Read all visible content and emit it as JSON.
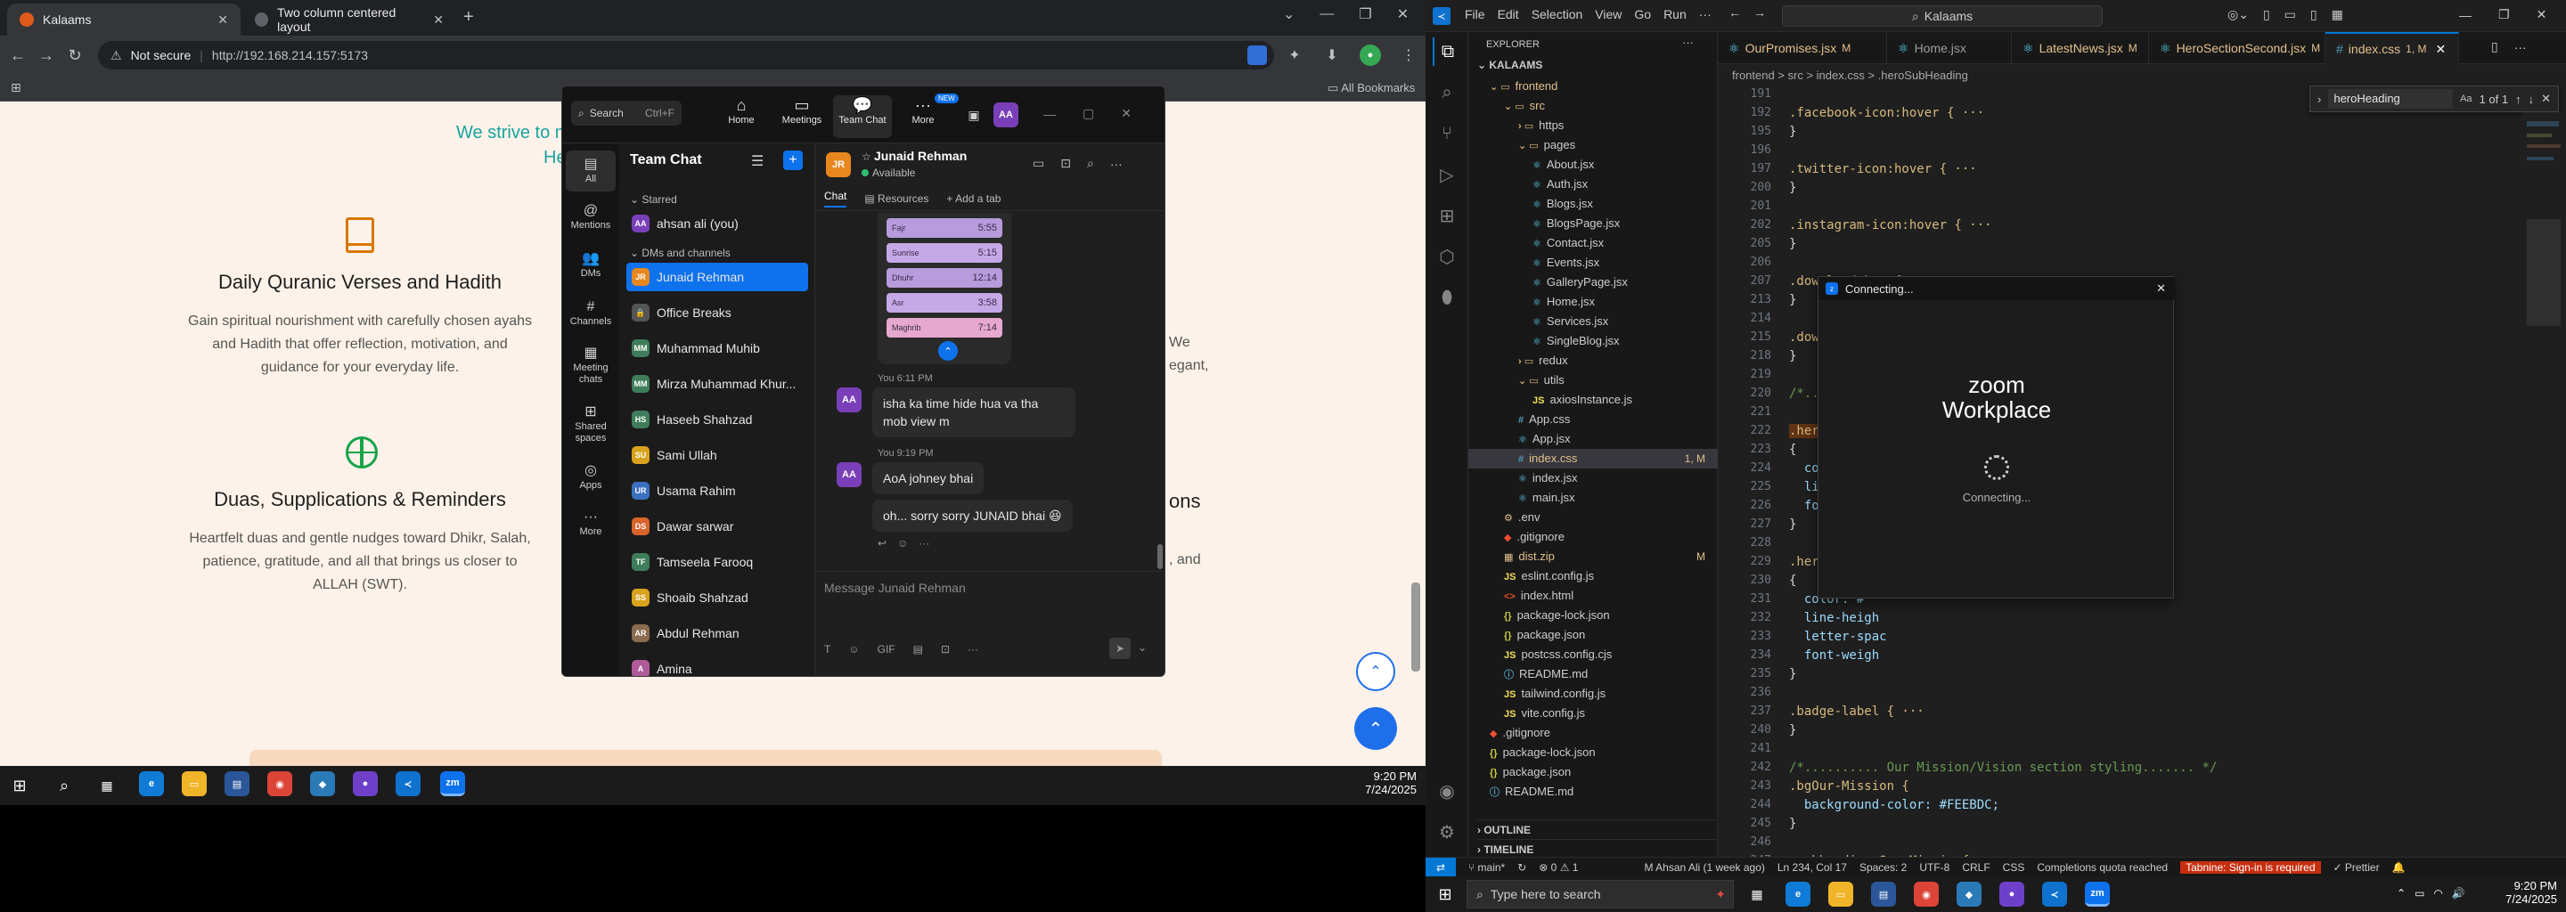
{
  "left": {
    "chrome": {
      "tabs": [
        {
          "title": "Kalaams",
          "active": true
        },
        {
          "title": "Two column centered layout",
          "active": false
        }
      ],
      "new_tab": "+",
      "not_secure": "Not secure",
      "url": "http://192.168.214.157:5173",
      "all_bookmarks": "All Bookmarks"
    },
    "page": {
      "tagline": "We strive to m",
      "tagline2": "He",
      "features": [
        {
          "title": "Daily Quranic Verses and Hadith",
          "desc": "Gain spiritual nourishment with carefully chosen ayahs and Hadith that offer reflection, motivation, and guidance for your everyday life."
        },
        {
          "title": "Duas, Supplications & Reminders",
          "desc": "Heartfelt duas and gentle nudges toward Dhikr, Salah, patience, gratitude, and all that brings us closer to ALLAH (SWT)."
        }
      ],
      "partial_right": [
        "We",
        "egant,",
        "ons",
        ", and"
      ]
    },
    "zoom": {
      "search_label": "Search",
      "search_shortcut": "Ctrl+F",
      "nav": [
        {
          "label": "Home",
          "icon": "home-icon"
        },
        {
          "label": "Meetings",
          "icon": "video-icon"
        },
        {
          "label": "Team Chat",
          "icon": "chat-icon"
        },
        {
          "label": "More",
          "icon": "more-icon"
        }
      ],
      "new_badge": "NEW",
      "user_initials": "AA",
      "rail": [
        {
          "label": "All"
        },
        {
          "label": "Mentions"
        },
        {
          "label": "DMs"
        },
        {
          "label": "Channels"
        },
        {
          "label": "Meeting chats"
        },
        {
          "label": "Shared spaces"
        },
        {
          "label": "Apps"
        },
        {
          "label": "More"
        }
      ],
      "team_chat_title": "Team Chat",
      "starred_label": "Starred",
      "starred_item": "ahsan ali (you)",
      "dms_label": "DMs and channels",
      "contacts": [
        {
          "name": "Junaid Rehman",
          "initials": "JR",
          "color": "#e8871e",
          "selected": true
        },
        {
          "name": "Office Breaks",
          "initials": "🔒",
          "color": "#555555",
          "selected": false
        },
        {
          "name": "Muhammad Muhib",
          "initials": "MM",
          "color": "#3f7d5a",
          "selected": false
        },
        {
          "name": "Mirza Muhammad Khur...",
          "initials": "MM",
          "color": "#3f7d5a",
          "selected": false
        },
        {
          "name": "Haseeb Shahzad",
          "initials": "HS",
          "color": "#3f7d5a",
          "selected": false
        },
        {
          "name": "Sami Ullah",
          "initials": "SU",
          "color": "#d9a21c",
          "selected": false
        },
        {
          "name": "Usama Rahim",
          "initials": "UR",
          "color": "#3b6fbf",
          "selected": false
        },
        {
          "name": "Dawar sarwar",
          "initials": "DS",
          "color": "#d8642c",
          "selected": false
        },
        {
          "name": "Tamseela Farooq",
          "initials": "TF",
          "color": "#3f7d5a",
          "selected": false
        },
        {
          "name": "Shoaib Shahzad",
          "initials": "SS",
          "color": "#d9a21c",
          "selected": false
        },
        {
          "name": "Abdul Rehman",
          "initials": "AR",
          "color": "#8a6b4f",
          "selected": false
        },
        {
          "name": "Amina",
          "initials": "A",
          "color": "#b05a9a",
          "selected": false
        }
      ],
      "conv_name": "Junaid Rehman",
      "conv_status": "Available",
      "conv_initials": "JR",
      "conv_tabs": [
        "Chat",
        "Resources",
        "Add a tab"
      ],
      "prayer_rows": [
        {
          "name": "Fajr",
          "time": "5:55"
        },
        {
          "name": "Sunrise",
          "time": "5:15"
        },
        {
          "name": "Dhuhr",
          "time": "12:14"
        },
        {
          "name": "Asr",
          "time": "3:58"
        },
        {
          "name": "Maghrib",
          "time": "7:14"
        }
      ],
      "messages": [
        {
          "meta": "You 6:11 PM",
          "text": "isha ka time hide hua va tha mob view m"
        },
        {
          "meta": "You 9:19 PM",
          "text": "AoA johney bhai"
        },
        {
          "meta": "",
          "text": "oh... sorry sorry JUNAID bhai 😆"
        }
      ],
      "sender_initials": "AA",
      "composer_placeholder": "Message Junaid Rehman"
    },
    "taskbar": {
      "time": "9:20 PM",
      "date": "7/24/2025"
    }
  },
  "right": {
    "vscode": {
      "menu": [
        "File",
        "Edit",
        "Selection",
        "View",
        "Go",
        "Run"
      ],
      "search_box": "Kalaams",
      "explorer_title": "EXPLORER",
      "root": "KALAAMS",
      "tree": [
        {
          "name": "frontend",
          "depth": 1,
          "type": "folder",
          "open": true,
          "color": "#e2c08d"
        },
        {
          "name": "src",
          "depth": 2,
          "type": "folder",
          "open": true,
          "color": "#e2c08d"
        },
        {
          "name": "https",
          "depth": 3,
          "type": "folder",
          "open": false,
          "color": "#cccccc"
        },
        {
          "name": "pages",
          "depth": 3,
          "type": "folder",
          "open": true,
          "color": "#cccccc"
        },
        {
          "name": "About.jsx",
          "depth": 4,
          "type": "jsx",
          "color": "#cccccc"
        },
        {
          "name": "Auth.jsx",
          "depth": 4,
          "type": "jsx",
          "color": "#cccccc"
        },
        {
          "name": "Blogs.jsx",
          "depth": 4,
          "type": "jsx",
          "color": "#cccccc"
        },
        {
          "name": "BlogsPage.jsx",
          "depth": 4,
          "type": "jsx",
          "color": "#cccccc"
        },
        {
          "name": "Contact.jsx",
          "depth": 4,
          "type": "jsx",
          "color": "#cccccc"
        },
        {
          "name": "Events.jsx",
          "depth": 4,
          "type": "jsx",
          "color": "#cccccc"
        },
        {
          "name": "GalleryPage.jsx",
          "depth": 4,
          "type": "jsx",
          "color": "#cccccc"
        },
        {
          "name": "Home.jsx",
          "depth": 4,
          "type": "jsx",
          "color": "#cccccc"
        },
        {
          "name": "Services.jsx",
          "depth": 4,
          "type": "jsx",
          "color": "#cccccc"
        },
        {
          "name": "SingleBlog.jsx",
          "depth": 4,
          "type": "jsx",
          "color": "#cccccc"
        },
        {
          "name": "redux",
          "depth": 3,
          "type": "folder",
          "open": false,
          "color": "#cccccc"
        },
        {
          "name": "utils",
          "depth": 3,
          "type": "folder",
          "open": true,
          "color": "#cccccc"
        },
        {
          "name": "axiosInstance.js",
          "depth": 4,
          "type": "js",
          "color": "#cccccc"
        },
        {
          "name": "App.css",
          "depth": 3,
          "type": "css",
          "color": "#cccccc"
        },
        {
          "name": "App.jsx",
          "depth": 3,
          "type": "jsx",
          "color": "#cccccc"
        },
        {
          "name": "index.css",
          "depth": 3,
          "type": "css",
          "color": "#e2c08d",
          "badge": "1, M",
          "selected": true
        },
        {
          "name": "index.jsx",
          "depth": 3,
          "type": "jsx",
          "color": "#cccccc"
        },
        {
          "name": "main.jsx",
          "depth": 3,
          "type": "jsx",
          "color": "#cccccc"
        },
        {
          "name": ".env",
          "depth": 2,
          "type": "env",
          "color": "#cccccc"
        },
        {
          "name": ".gitignore",
          "depth": 2,
          "type": "git",
          "color": "#cccccc"
        },
        {
          "name": "dist.zip",
          "depth": 2,
          "type": "zip",
          "color": "#e2c08d",
          "badge": "M"
        },
        {
          "name": "eslint.config.js",
          "depth": 2,
          "type": "js",
          "color": "#cccccc"
        },
        {
          "name": "index.html",
          "depth": 2,
          "type": "html",
          "color": "#cccccc"
        },
        {
          "name": "package-lock.json",
          "depth": 2,
          "type": "json",
          "color": "#cccccc"
        },
        {
          "name": "package.json",
          "depth": 2,
          "type": "json",
          "color": "#cccccc"
        },
        {
          "name": "postcss.config.cjs",
          "depth": 2,
          "type": "js",
          "color": "#cccccc"
        },
        {
          "name": "README.md",
          "depth": 2,
          "type": "md",
          "color": "#cccccc"
        },
        {
          "name": "tailwind.config.js",
          "depth": 2,
          "type": "js",
          "color": "#cccccc"
        },
        {
          "name": "vite.config.js",
          "depth": 2,
          "type": "js",
          "color": "#cccccc"
        },
        {
          "name": ".gitignore",
          "depth": 1,
          "type": "git",
          "color": "#cccccc"
        },
        {
          "name": "package-lock.json",
          "depth": 1,
          "type": "json",
          "color": "#cccccc"
        },
        {
          "name": "package.json",
          "depth": 1,
          "type": "json",
          "color": "#cccccc"
        },
        {
          "name": "README.md",
          "depth": 1,
          "type": "md",
          "color": "#cccccc"
        }
      ],
      "outline_label": "OUTLINE",
      "timeline_label": "TIMELINE",
      "tabs": [
        {
          "name": "OurPromises.jsx",
          "badge": "M",
          "active": false
        },
        {
          "name": "Home.jsx",
          "badge": "",
          "active": false
        },
        {
          "name": "LatestNews.jsx",
          "badge": "M",
          "active": false
        },
        {
          "name": "HeroSectionSecond.jsx",
          "badge": "M",
          "active": false
        },
        {
          "name": "index.css",
          "badge": "1, M",
          "active": true
        }
      ],
      "breadcrumb": "frontend  >  src  >  index.css  >  .heroSubHeading",
      "find_query": "heroHeading",
      "find_result": "1 of 1",
      "code_lines": [
        {
          "n": "191",
          "t": ""
        },
        {
          "n": "192",
          "t": ".facebook-icon:hover { ···",
          "kind": "sel"
        },
        {
          "n": "195",
          "t": "}"
        },
        {
          "n": "196",
          "t": ""
        },
        {
          "n": "197",
          "t": ".twitter-icon:hover { ···",
          "kind": "sel"
        },
        {
          "n": "200",
          "t": "}"
        },
        {
          "n": "201",
          "t": ""
        },
        {
          "n": "202",
          "t": ".instagram-icon:hover { ···",
          "kind": "sel"
        },
        {
          "n": "205",
          "t": "}"
        },
        {
          "n": "206",
          "t": ""
        },
        {
          "n": "207",
          "t": ".download-btn { ···",
          "kind": "sel"
        },
        {
          "n": "213",
          "t": "}"
        },
        {
          "n": "214",
          "t": ""
        },
        {
          "n": "215",
          "t": ".download-btn",
          "kind": "sel"
        },
        {
          "n": "218",
          "t": "}"
        },
        {
          "n": "219",
          "t": ""
        },
        {
          "n": "220",
          "t": "/*..........",
          "kind": "cmt"
        },
        {
          "n": "221",
          "t": ""
        },
        {
          "n": "222",
          "t": ".heroHeading",
          "kind": "hl"
        },
        {
          "n": "223",
          "t": "{"
        },
        {
          "n": "224",
          "t": "  color: #f",
          "kind": "prop"
        },
        {
          "n": "225",
          "t": "  line-heigh",
          "kind": "prop"
        },
        {
          "n": "226",
          "t": "  font-weigh",
          "kind": "prop"
        },
        {
          "n": "227",
          "t": "}"
        },
        {
          "n": "228",
          "t": ""
        },
        {
          "n": "229",
          "t": ".heroSubHeadi",
          "kind": "sel"
        },
        {
          "n": "230",
          "t": "{"
        },
        {
          "n": "231",
          "t": "  color: #",
          "kind": "prop"
        },
        {
          "n": "232",
          "t": "  line-heigh",
          "kind": "prop"
        },
        {
          "n": "233",
          "t": "  letter-spac",
          "kind": "prop"
        },
        {
          "n": "234",
          "t": "  font-weigh",
          "kind": "prop"
        },
        {
          "n": "235",
          "t": "}"
        },
        {
          "n": "236",
          "t": ""
        },
        {
          "n": "237",
          "t": ".badge-label { ···",
          "kind": "sel"
        },
        {
          "n": "240",
          "t": "}"
        },
        {
          "n": "241",
          "t": ""
        },
        {
          "n": "242",
          "t": "/*.......... Our Mission/Vision section styling....... */",
          "kind": "cmt"
        },
        {
          "n": "243",
          "t": ".bgOur-Mission {",
          "kind": "sel"
        },
        {
          "n": "244",
          "t": "  background-color: #FEEBDC;",
          "kind": "prop"
        },
        {
          "n": "245",
          "t": "}"
        },
        {
          "n": "246",
          "t": ""
        },
        {
          "n": "247",
          "t": ".subheading-Our-Mission{",
          "kind": "sel"
        },
        {
          "n": "248",
          "t": "color: #0037D6;",
          "kind": "prop"
        },
        {
          "n": "249",
          "t": "}"
        },
        {
          "n": "250",
          "t": ""
        },
        {
          "n": "251",
          "t": ".mainheading-Our-Mission{ ···",
          "kind": "sel"
        }
      ],
      "zoom_connecting_title": "Connecting...",
      "zoom_brand_1": "zoom",
      "zoom_brand_2": "Workplace",
      "zoom_connecting_text": "Connecting...",
      "status": {
        "branch": "main*",
        "errors": "⊗ 0 ⚠ 1",
        "blame": "M Ahsan Ali (1 week ago)",
        "position": "Ln 234, Col 17",
        "spaces": "Spaces: 2",
        "encoding": "UTF-8",
        "eol": "CRLF",
        "lang": "CSS",
        "quota": "Completions quota reached",
        "tabnine": "Tabnine: Sign-in is required",
        "prettier": "Prettier"
      }
    },
    "taskbar": {
      "search_placeholder": "Type here to search",
      "time": "9:20 PM",
      "date": "7/24/2025"
    }
  }
}
